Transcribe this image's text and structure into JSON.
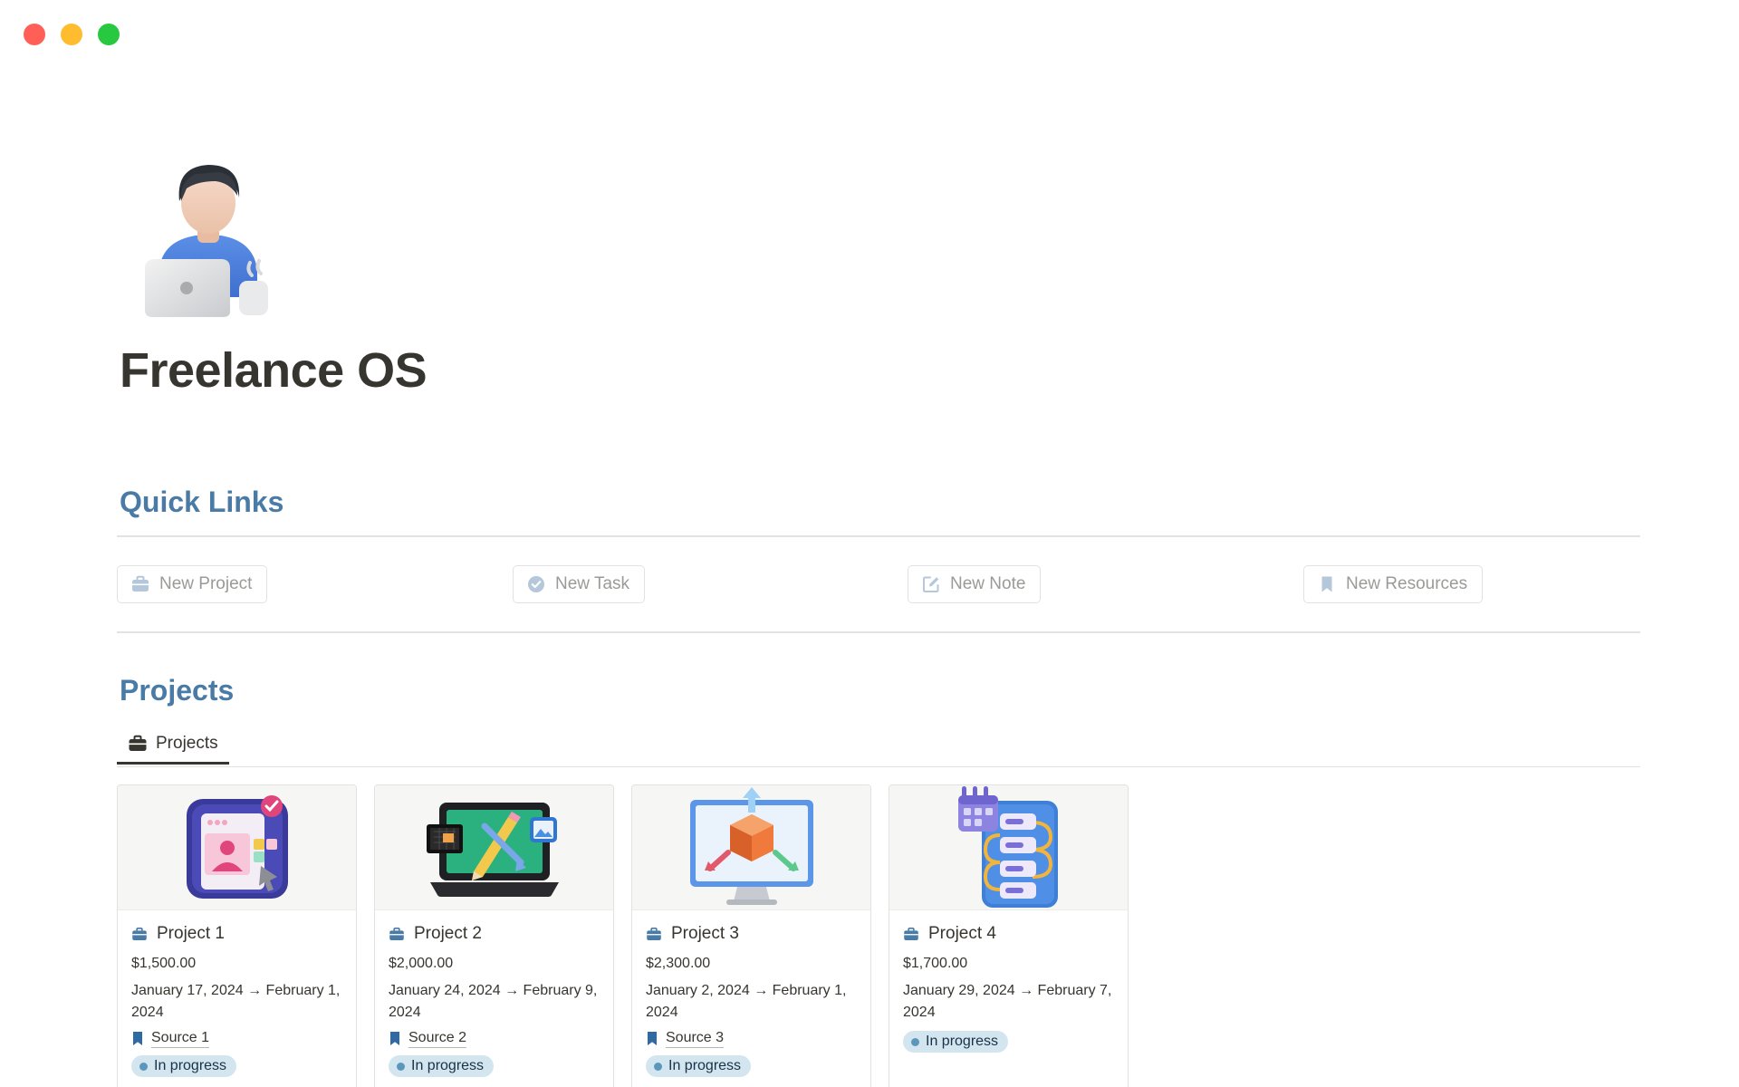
{
  "page": {
    "title": "Freelance OS"
  },
  "sections": {
    "quick_links_heading": "Quick Links",
    "projects_heading": "Projects"
  },
  "quick_links": [
    {
      "label": "New Project",
      "icon": "briefcase-icon"
    },
    {
      "label": "New Task",
      "icon": "check-circle-icon"
    },
    {
      "label": "New Note",
      "icon": "edit-icon"
    },
    {
      "label": "New Resources",
      "icon": "bookmark-icon"
    }
  ],
  "views": {
    "active_tab": "Projects"
  },
  "projects": [
    {
      "name": "Project 1",
      "budget": "$1,500.00",
      "dates": "January 17, 2024 → February 1, 2024",
      "source": "Source 1",
      "status": "In progress"
    },
    {
      "name": "Project 2",
      "budget": "$2,000.00",
      "dates": "January 24, 2024 → February 9, 2024",
      "source": "Source 2",
      "status": "In progress"
    },
    {
      "name": "Project 3",
      "budget": "$2,300.00",
      "dates": "January 2, 2024 → February 1, 2024",
      "source": "Source 3",
      "status": "In progress"
    },
    {
      "name": "Project 4",
      "budget": "$1,700.00",
      "dates": "January 29, 2024 → February 7, 2024",
      "status": "In progress"
    }
  ],
  "colors": {
    "heading_accent": "#4a7ba7",
    "status_pill_bg": "#d3e5ef",
    "status_dot": "#5b97bd",
    "icon_blue": "#4a7ba7"
  }
}
